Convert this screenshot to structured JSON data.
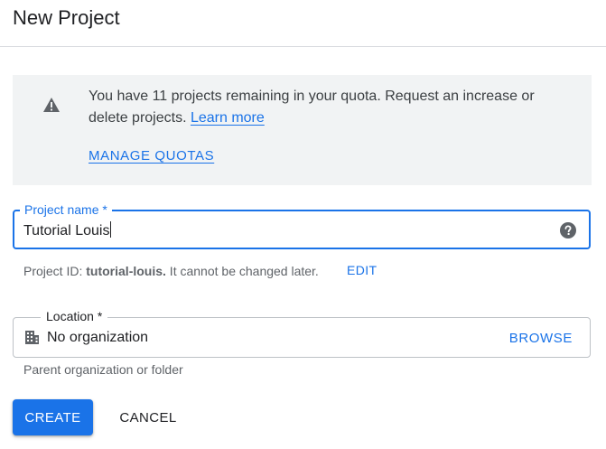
{
  "header": {
    "title": "New Project"
  },
  "quota_notice": {
    "icon": "warning-icon",
    "message": "You have 11 projects remaining in your quota. Request an increase or delete projects. ",
    "learn_more_label": "Learn more",
    "manage_quotas_label": "MANAGE QUOTAS"
  },
  "project_name": {
    "label": "Project name *",
    "value": "Tutorial Louis",
    "help_icon": "help-icon"
  },
  "project_id": {
    "prefix": "Project ID: ",
    "value": "tutorial-louis.",
    "suffix": " It cannot be changed later.",
    "edit_label": "EDIT"
  },
  "location": {
    "label": "Location *",
    "icon": "building-icon",
    "value": "No organization",
    "browse_label": "BROWSE",
    "helper_text": "Parent organization or folder"
  },
  "actions": {
    "create_label": "CREATE",
    "cancel_label": "CANCEL"
  },
  "colors": {
    "accent": "#1a73e8",
    "notice_background": "#f1f3f4",
    "text_secondary": "#5f6368"
  }
}
